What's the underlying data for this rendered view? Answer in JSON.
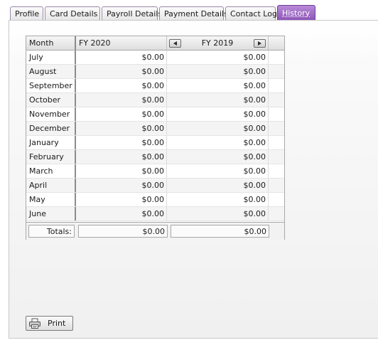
{
  "tabs": [
    {
      "label": "Profile"
    },
    {
      "label": "Card Details"
    },
    {
      "label": "Payroll Details"
    },
    {
      "label": "Payment Details"
    },
    {
      "label": "Contact Log"
    },
    {
      "label": "History"
    }
  ],
  "active_tab": "History",
  "colors": {
    "active_tab": "#9a62c4"
  },
  "grid": {
    "headers": {
      "month": "Month",
      "fy1": "FY 2020",
      "fy2": "FY 2019"
    },
    "nav": {
      "prev_icon": "triangle-left-icon",
      "next_icon": "triangle-right-icon"
    },
    "rows": [
      {
        "month": "July",
        "fy1": "$0.00",
        "fy2": "$0.00"
      },
      {
        "month": "August",
        "fy1": "$0.00",
        "fy2": "$0.00"
      },
      {
        "month": "September",
        "fy1": "$0.00",
        "fy2": "$0.00"
      },
      {
        "month": "October",
        "fy1": "$0.00",
        "fy2": "$0.00"
      },
      {
        "month": "November",
        "fy1": "$0.00",
        "fy2": "$0.00"
      },
      {
        "month": "December",
        "fy1": "$0.00",
        "fy2": "$0.00"
      },
      {
        "month": "January",
        "fy1": "$0.00",
        "fy2": "$0.00"
      },
      {
        "month": "February",
        "fy1": "$0.00",
        "fy2": "$0.00"
      },
      {
        "month": "March",
        "fy1": "$0.00",
        "fy2": "$0.00"
      },
      {
        "month": "April",
        "fy1": "$0.00",
        "fy2": "$0.00"
      },
      {
        "month": "May",
        "fy1": "$0.00",
        "fy2": "$0.00"
      },
      {
        "month": "June",
        "fy1": "$0.00",
        "fy2": "$0.00"
      }
    ],
    "totals": {
      "label": "Totals:",
      "fy1": "$0.00",
      "fy2": "$0.00"
    }
  },
  "print_button": {
    "label": "Print",
    "icon": "printer-icon"
  }
}
